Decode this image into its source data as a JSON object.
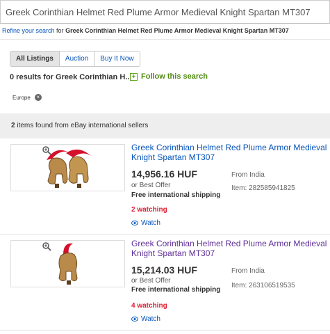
{
  "search": {
    "query": "Greek Corinthian Helmet Red Plume Armor Medieval Knight Spartan MT307"
  },
  "refine": {
    "link": "Refine your search",
    "mid": " for ",
    "query": "Greek Corinthian Helmet Red Plume Armor Medieval Knight Spartan MT307"
  },
  "tabs": [
    {
      "label": "All Listings"
    },
    {
      "label": "Auction"
    },
    {
      "label": "Buy It Now"
    }
  ],
  "results": {
    "prefix": "0 results for ",
    "query": "Greek Corinthian H..."
  },
  "follow": {
    "label": "Follow this search"
  },
  "filter_chip": {
    "label": "Europe"
  },
  "banner": {
    "count": "2",
    "text": " items found from eBay international sellers"
  },
  "items": [
    {
      "title": "Greek Corinthian Helmet Red Plume Armor Medieval Knight Spartan MT307",
      "price": "14,956.16 HUF",
      "offer": "or Best Offer",
      "shipping": "Free international shipping",
      "origin": "From India",
      "item_no": "Item: 282585941825",
      "watching": "2 watching",
      "watch": "Watch"
    },
    {
      "title": "Greek Corinthian Helmet Red Plume Armor Medieval Knight Spartan MT307",
      "price": "15,214.03 HUF",
      "offer": "or Best Offer",
      "shipping": "Free international shipping",
      "origin": "From India",
      "item_no": "Item: 263106519535",
      "watching": "4 watching",
      "watch": "Watch"
    }
  ],
  "colors": {
    "link": "#0654ba",
    "visited": "#5e2e96",
    "watching": "#dd1e31",
    "follow": "#4f8a10"
  }
}
